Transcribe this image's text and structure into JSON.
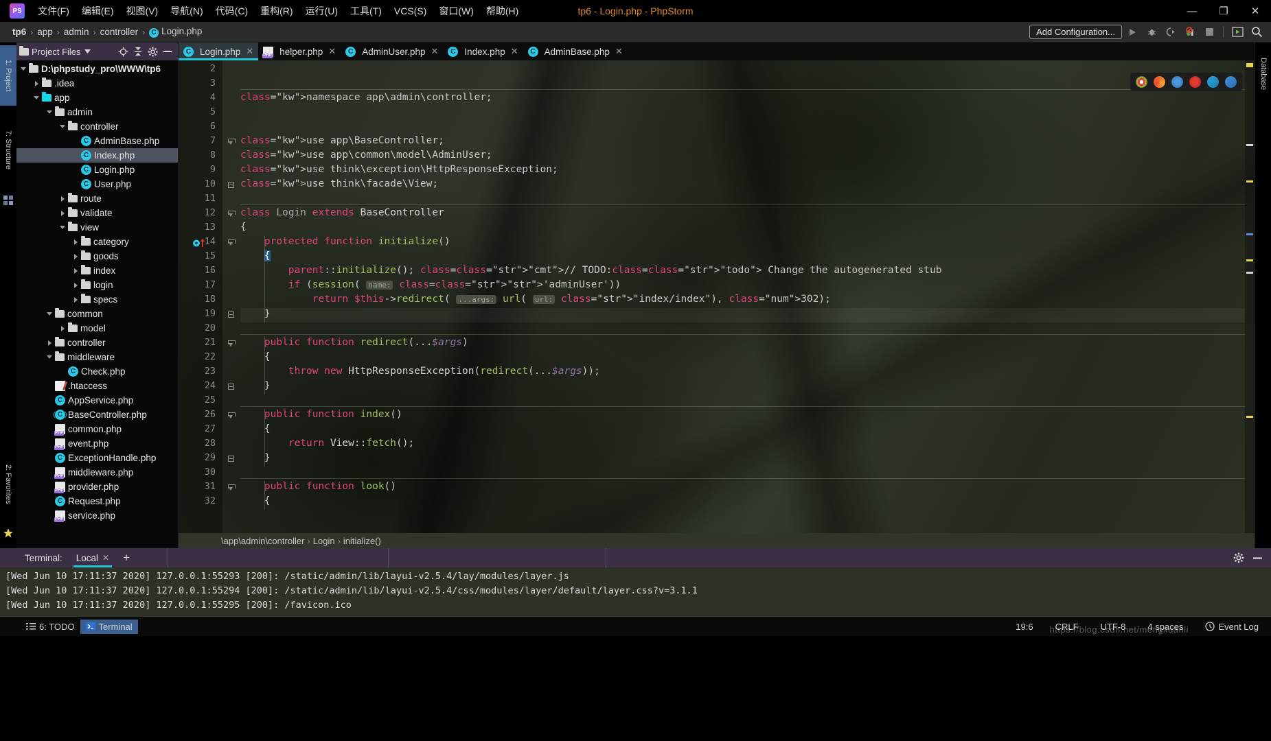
{
  "window": {
    "title": "tp6 - Login.php - PhpStorm",
    "logo_text": "PS",
    "minimize": "—",
    "maximize": "❐",
    "close": "✕"
  },
  "menubar": {
    "items": [
      {
        "label": "文件(F)",
        "name": "menu-file"
      },
      {
        "label": "编辑(E)",
        "name": "menu-edit"
      },
      {
        "label": "视图(V)",
        "name": "menu-view"
      },
      {
        "label": "导航(N)",
        "name": "menu-navigate"
      },
      {
        "label": "代码(C)",
        "name": "menu-code"
      },
      {
        "label": "重构(R)",
        "name": "menu-refactor"
      },
      {
        "label": "运行(U)",
        "name": "menu-run"
      },
      {
        "label": "工具(T)",
        "name": "menu-tools"
      },
      {
        "label": "VCS(S)",
        "name": "menu-vcs"
      },
      {
        "label": "窗口(W)",
        "name": "menu-window"
      },
      {
        "label": "帮助(H)",
        "name": "menu-help"
      }
    ]
  },
  "navbar": {
    "breadcrumb": [
      "tp6",
      "app",
      "admin",
      "controller",
      "Login.php"
    ],
    "file_icon_letter": "C",
    "add_configuration": "Add Configuration...",
    "separator": "›"
  },
  "tool_stripes": {
    "left_top": "1: Project",
    "left_mid": "7: Structure",
    "left_bottom": "2: Favorites",
    "right_top": "Database"
  },
  "project_panel": {
    "title": "Project Files",
    "tree": [
      {
        "label": "D:\\phpstudy_pro\\WWW\\tp6",
        "depth": 0,
        "type": "folder",
        "state": "open",
        "bold": true
      },
      {
        "label": ".idea",
        "depth": 1,
        "type": "folder",
        "state": "closed"
      },
      {
        "label": "app",
        "depth": 1,
        "type": "folder-cyan",
        "state": "open"
      },
      {
        "label": "admin",
        "depth": 2,
        "type": "folder",
        "state": "open"
      },
      {
        "label": "controller",
        "depth": 3,
        "type": "folder",
        "state": "open"
      },
      {
        "label": "AdminBase.php",
        "depth": 4,
        "type": "php-class"
      },
      {
        "label": "Index.php",
        "depth": 4,
        "type": "php-class",
        "selected": true
      },
      {
        "label": "Login.php",
        "depth": 4,
        "type": "php-class"
      },
      {
        "label": "User.php",
        "depth": 4,
        "type": "php-class"
      },
      {
        "label": "route",
        "depth": 3,
        "type": "folder",
        "state": "closed"
      },
      {
        "label": "validate",
        "depth": 3,
        "type": "folder",
        "state": "closed"
      },
      {
        "label": "view",
        "depth": 3,
        "type": "folder",
        "state": "open"
      },
      {
        "label": "category",
        "depth": 4,
        "type": "folder",
        "state": "closed"
      },
      {
        "label": "goods",
        "depth": 4,
        "type": "folder",
        "state": "closed"
      },
      {
        "label": "index",
        "depth": 4,
        "type": "folder",
        "state": "closed"
      },
      {
        "label": "login",
        "depth": 4,
        "type": "folder",
        "state": "closed"
      },
      {
        "label": "specs",
        "depth": 4,
        "type": "folder",
        "state": "closed"
      },
      {
        "label": "common",
        "depth": 2,
        "type": "folder",
        "state": "open"
      },
      {
        "label": "model",
        "depth": 3,
        "type": "folder",
        "state": "closed"
      },
      {
        "label": "controller",
        "depth": 2,
        "type": "folder",
        "state": "closed"
      },
      {
        "label": "middleware",
        "depth": 2,
        "type": "folder",
        "state": "open"
      },
      {
        "label": "Check.php",
        "depth": 3,
        "type": "php-class"
      },
      {
        "label": ".htaccess",
        "depth": 2,
        "type": "htaccess"
      },
      {
        "label": "AppService.php",
        "depth": 2,
        "type": "php-class"
      },
      {
        "label": "BaseController.php",
        "depth": 2,
        "type": "php-abstract"
      },
      {
        "label": "common.php",
        "depth": 2,
        "type": "php-file"
      },
      {
        "label": "event.php",
        "depth": 2,
        "type": "php-file"
      },
      {
        "label": "ExceptionHandle.php",
        "depth": 2,
        "type": "php-class"
      },
      {
        "label": "middleware.php",
        "depth": 2,
        "type": "php-file"
      },
      {
        "label": "provider.php",
        "depth": 2,
        "type": "php-file"
      },
      {
        "label": "Request.php",
        "depth": 2,
        "type": "php-class"
      },
      {
        "label": "service.php",
        "depth": 2,
        "type": "php-file"
      }
    ]
  },
  "editor": {
    "tabs": [
      {
        "label": "Login.php",
        "icon": "php-class",
        "active": true
      },
      {
        "label": "helper.php",
        "icon": "php-file",
        "active": false
      },
      {
        "label": "AdminUser.php",
        "icon": "php-class",
        "active": false
      },
      {
        "label": "Index.php",
        "icon": "php-class",
        "active": false
      },
      {
        "label": "AdminBase.php",
        "icon": "php-class",
        "active": false
      }
    ],
    "first_line_number": 2,
    "last_line_number": 32,
    "breadcrumb": [
      "\\app\\admin\\controller",
      "Login",
      "initialize()"
    ],
    "breadcrumb_sep": "›",
    "lines": [
      {
        "n": 2,
        "text": ""
      },
      {
        "n": 3,
        "text": ""
      },
      {
        "n": 4,
        "text": "namespace app\\admin\\controller;"
      },
      {
        "n": 5,
        "text": ""
      },
      {
        "n": 6,
        "text": ""
      },
      {
        "n": 7,
        "text": "use app\\BaseController;"
      },
      {
        "n": 8,
        "text": "use app\\common\\model\\AdminUser;"
      },
      {
        "n": 9,
        "text": "use think\\exception\\HttpResponseException;"
      },
      {
        "n": 10,
        "text": "use think\\facade\\View;"
      },
      {
        "n": 11,
        "text": ""
      },
      {
        "n": 12,
        "text": "class Login extends BaseController"
      },
      {
        "n": 13,
        "text": "{"
      },
      {
        "n": 14,
        "text": "    protected function initialize()"
      },
      {
        "n": 15,
        "text": "    {"
      },
      {
        "n": 16,
        "text": "        parent::initialize(); // TODO: Change the autogenerated stub"
      },
      {
        "n": 17,
        "text": "        if (session( name: 'adminUser'))"
      },
      {
        "n": 18,
        "text": "            return $this->redirect( ...args: url( url: \"index/index\"), 302);"
      },
      {
        "n": 19,
        "text": "    }"
      },
      {
        "n": 20,
        "text": ""
      },
      {
        "n": 21,
        "text": "    public function redirect(...$args)"
      },
      {
        "n": 22,
        "text": "    {"
      },
      {
        "n": 23,
        "text": "        throw new HttpResponseException(redirect(...$args));"
      },
      {
        "n": 24,
        "text": "    }"
      },
      {
        "n": 25,
        "text": ""
      },
      {
        "n": 26,
        "text": "    public function index()"
      },
      {
        "n": 27,
        "text": "    {"
      },
      {
        "n": 28,
        "text": "        return View::fetch();"
      },
      {
        "n": 29,
        "text": "    }"
      },
      {
        "n": 30,
        "text": ""
      },
      {
        "n": 31,
        "text": "    public function look()"
      },
      {
        "n": 32,
        "text": "    {"
      }
    ],
    "param_hints": {
      "session_name": "name:",
      "redirect_args": "...args:",
      "url_param": "url:"
    }
  },
  "terminal": {
    "label": "Terminal:",
    "tab": "Local",
    "add_tab": "+",
    "lines": [
      "[Wed Jun 10 17:11:37 2020] 127.0.0.1:55293 [200]: /static/admin/lib/layui-v2.5.4/lay/modules/layer.js",
      "[Wed Jun 10 17:11:37 2020] 127.0.0.1:55294 [200]: /static/admin/lib/layui-v2.5.4/css/modules/layer/default/layer.css?v=3.1.1",
      "[Wed Jun 10 17:11:37 2020] 127.0.0.1:55295 [200]: /favicon.ico"
    ]
  },
  "statusbar": {
    "todo": "6: TODO",
    "terminal": "Terminal",
    "caret": "19:6",
    "line_sep": "CRLF",
    "encoding": "UTF-8",
    "indent": "4 spaces",
    "event_log": "Event Log",
    "watermark": "https://blog.csdn.net/mengxuanli"
  },
  "colors": {
    "accent_cyan": "#24c8db",
    "title_orange": "#e08a2a",
    "selection_blue": "#3a5f8f",
    "panel_purple": "#3b2f46",
    "editor_green": "#2c3226"
  }
}
